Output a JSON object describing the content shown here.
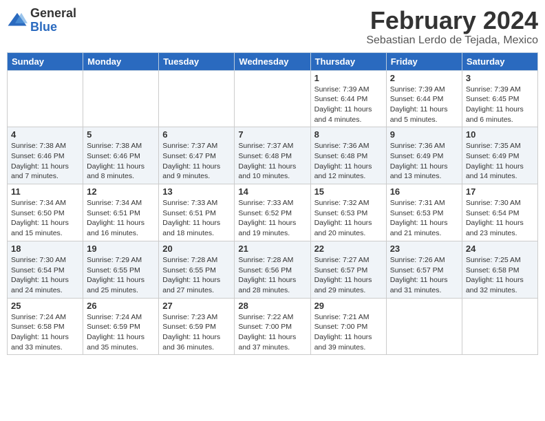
{
  "header": {
    "logo_general": "General",
    "logo_blue": "Blue",
    "title": "February 2024",
    "subtitle": "Sebastian Lerdo de Tejada, Mexico"
  },
  "days_of_week": [
    "Sunday",
    "Monday",
    "Tuesday",
    "Wednesday",
    "Thursday",
    "Friday",
    "Saturday"
  ],
  "weeks": [
    [
      {
        "day": "",
        "info": ""
      },
      {
        "day": "",
        "info": ""
      },
      {
        "day": "",
        "info": ""
      },
      {
        "day": "",
        "info": ""
      },
      {
        "day": "1",
        "info": "Sunrise: 7:39 AM\nSunset: 6:44 PM\nDaylight: 11 hours\nand 4 minutes."
      },
      {
        "day": "2",
        "info": "Sunrise: 7:39 AM\nSunset: 6:44 PM\nDaylight: 11 hours\nand 5 minutes."
      },
      {
        "day": "3",
        "info": "Sunrise: 7:39 AM\nSunset: 6:45 PM\nDaylight: 11 hours\nand 6 minutes."
      }
    ],
    [
      {
        "day": "4",
        "info": "Sunrise: 7:38 AM\nSunset: 6:46 PM\nDaylight: 11 hours\nand 7 minutes."
      },
      {
        "day": "5",
        "info": "Sunrise: 7:38 AM\nSunset: 6:46 PM\nDaylight: 11 hours\nand 8 minutes."
      },
      {
        "day": "6",
        "info": "Sunrise: 7:37 AM\nSunset: 6:47 PM\nDaylight: 11 hours\nand 9 minutes."
      },
      {
        "day": "7",
        "info": "Sunrise: 7:37 AM\nSunset: 6:48 PM\nDaylight: 11 hours\nand 10 minutes."
      },
      {
        "day": "8",
        "info": "Sunrise: 7:36 AM\nSunset: 6:48 PM\nDaylight: 11 hours\nand 12 minutes."
      },
      {
        "day": "9",
        "info": "Sunrise: 7:36 AM\nSunset: 6:49 PM\nDaylight: 11 hours\nand 13 minutes."
      },
      {
        "day": "10",
        "info": "Sunrise: 7:35 AM\nSunset: 6:49 PM\nDaylight: 11 hours\nand 14 minutes."
      }
    ],
    [
      {
        "day": "11",
        "info": "Sunrise: 7:34 AM\nSunset: 6:50 PM\nDaylight: 11 hours\nand 15 minutes."
      },
      {
        "day": "12",
        "info": "Sunrise: 7:34 AM\nSunset: 6:51 PM\nDaylight: 11 hours\nand 16 minutes."
      },
      {
        "day": "13",
        "info": "Sunrise: 7:33 AM\nSunset: 6:51 PM\nDaylight: 11 hours\nand 18 minutes."
      },
      {
        "day": "14",
        "info": "Sunrise: 7:33 AM\nSunset: 6:52 PM\nDaylight: 11 hours\nand 19 minutes."
      },
      {
        "day": "15",
        "info": "Sunrise: 7:32 AM\nSunset: 6:53 PM\nDaylight: 11 hours\nand 20 minutes."
      },
      {
        "day": "16",
        "info": "Sunrise: 7:31 AM\nSunset: 6:53 PM\nDaylight: 11 hours\nand 21 minutes."
      },
      {
        "day": "17",
        "info": "Sunrise: 7:30 AM\nSunset: 6:54 PM\nDaylight: 11 hours\nand 23 minutes."
      }
    ],
    [
      {
        "day": "18",
        "info": "Sunrise: 7:30 AM\nSunset: 6:54 PM\nDaylight: 11 hours\nand 24 minutes."
      },
      {
        "day": "19",
        "info": "Sunrise: 7:29 AM\nSunset: 6:55 PM\nDaylight: 11 hours\nand 25 minutes."
      },
      {
        "day": "20",
        "info": "Sunrise: 7:28 AM\nSunset: 6:55 PM\nDaylight: 11 hours\nand 27 minutes."
      },
      {
        "day": "21",
        "info": "Sunrise: 7:28 AM\nSunset: 6:56 PM\nDaylight: 11 hours\nand 28 minutes."
      },
      {
        "day": "22",
        "info": "Sunrise: 7:27 AM\nSunset: 6:57 PM\nDaylight: 11 hours\nand 29 minutes."
      },
      {
        "day": "23",
        "info": "Sunrise: 7:26 AM\nSunset: 6:57 PM\nDaylight: 11 hours\nand 31 minutes."
      },
      {
        "day": "24",
        "info": "Sunrise: 7:25 AM\nSunset: 6:58 PM\nDaylight: 11 hours\nand 32 minutes."
      }
    ],
    [
      {
        "day": "25",
        "info": "Sunrise: 7:24 AM\nSunset: 6:58 PM\nDaylight: 11 hours\nand 33 minutes."
      },
      {
        "day": "26",
        "info": "Sunrise: 7:24 AM\nSunset: 6:59 PM\nDaylight: 11 hours\nand 35 minutes."
      },
      {
        "day": "27",
        "info": "Sunrise: 7:23 AM\nSunset: 6:59 PM\nDaylight: 11 hours\nand 36 minutes."
      },
      {
        "day": "28",
        "info": "Sunrise: 7:22 AM\nSunset: 7:00 PM\nDaylight: 11 hours\nand 37 minutes."
      },
      {
        "day": "29",
        "info": "Sunrise: 7:21 AM\nSunset: 7:00 PM\nDaylight: 11 hours\nand 39 minutes."
      },
      {
        "day": "",
        "info": ""
      },
      {
        "day": "",
        "info": ""
      }
    ]
  ]
}
